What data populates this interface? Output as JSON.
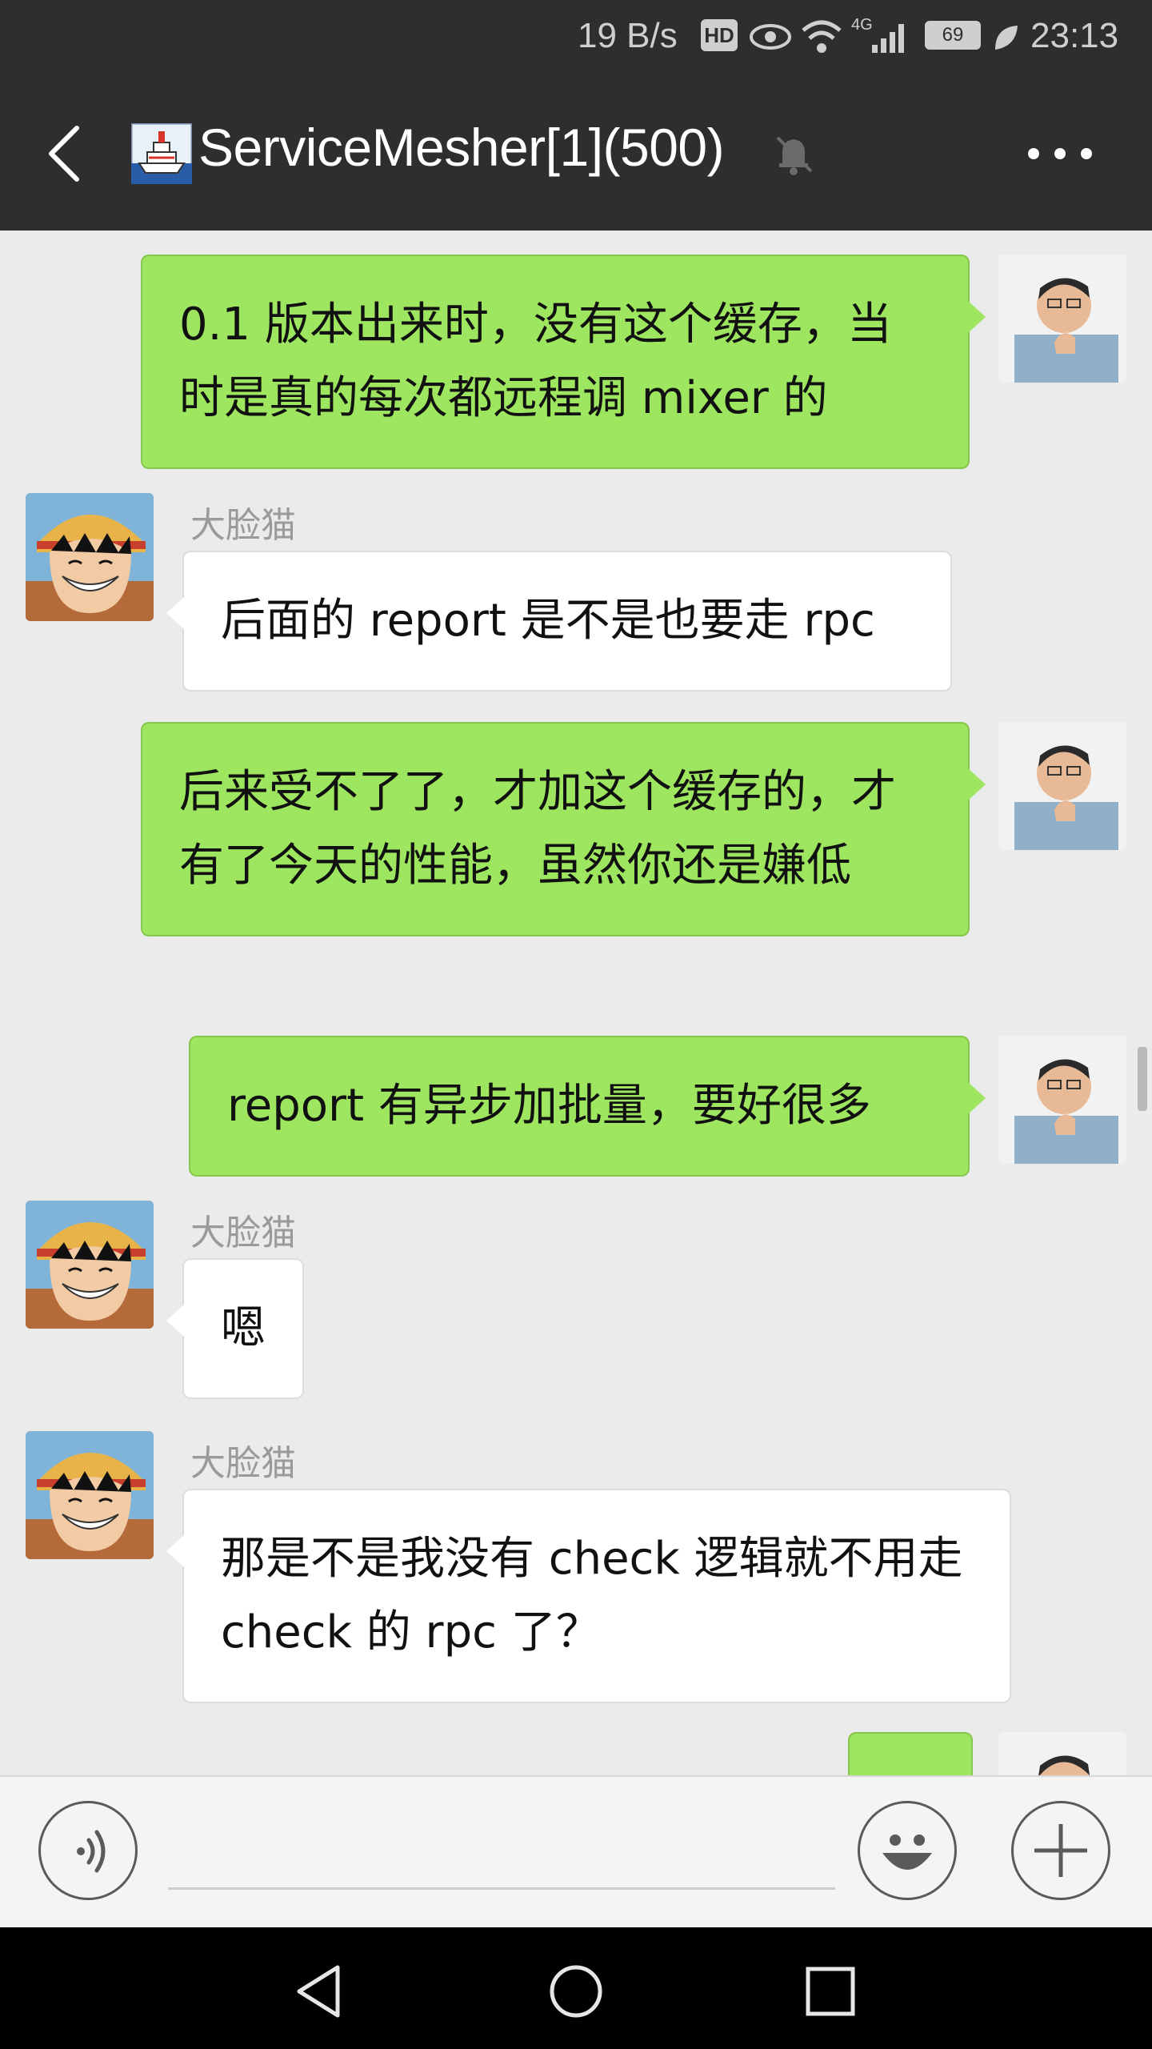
{
  "status_bar": {
    "network_speed": "19 B/s",
    "hd_badge": "HD",
    "network_type": "4G",
    "battery": "69",
    "time": "23:13"
  },
  "header": {
    "title": "ServiceMesher[1](500)",
    "back_icon": "chevron-left-icon",
    "muted_icon": "bell-muted-icon",
    "more_icon": "more-dots-icon"
  },
  "messages": [
    {
      "direction": "out",
      "text": "0.1 版本出来时，没有这个缓存，当时是真的每次都远程调 mixer 的"
    },
    {
      "direction": "in",
      "sender": "大脸猫",
      "text": "后面的 report 是不是也要走 rpc"
    },
    {
      "direction": "out",
      "text": "后来受不了了，才加这个缓存的，才有了今天的性能，虽然你还是嫌低"
    },
    {
      "direction": "out",
      "text": "report 有异步加批量，要好很多"
    },
    {
      "direction": "in",
      "sender": "大脸猫",
      "text": "嗯"
    },
    {
      "direction": "in",
      "sender": "大脸猫",
      "text": "那是不是我没有 check 逻辑就不用走 check 的 rpc 了？"
    }
  ],
  "input_bar": {
    "voice_icon": "voice-icon",
    "emoji_icon": "emoji-icon",
    "plus_icon": "plus-icon",
    "input_value": ""
  },
  "colors": {
    "outgoing_bubble": "#9ee65f",
    "incoming_bubble": "#ffffff",
    "header_bg": "#2e2e2e",
    "chat_bg": "#ebebeb"
  }
}
